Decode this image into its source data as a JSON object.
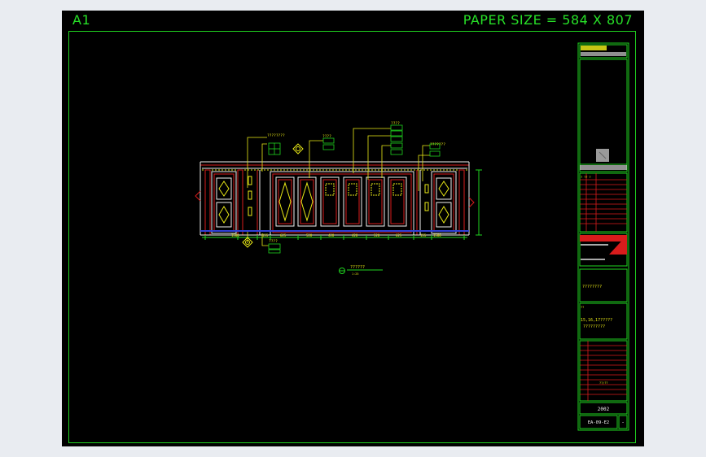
{
  "sheet": {
    "id": "A1",
    "paper_size": "PAPER SIZE = 584 X 807"
  },
  "title_block": {
    "stage": "2002",
    "drawing_number": "EA-09-E2",
    "revision": "-",
    "client_note": "????????",
    "sheet_ref_line1": "15,16,17?????",
    "sheet_ref_line2": "?????????"
  },
  "elevation": {
    "caption": "??????",
    "scale": "1:25"
  },
  "colors": {
    "frame": "#1fd31f",
    "panel": "#d91c1c",
    "annotation": "#e9e917",
    "outline": "#f0f0f0",
    "base": "#2f40d8"
  }
}
